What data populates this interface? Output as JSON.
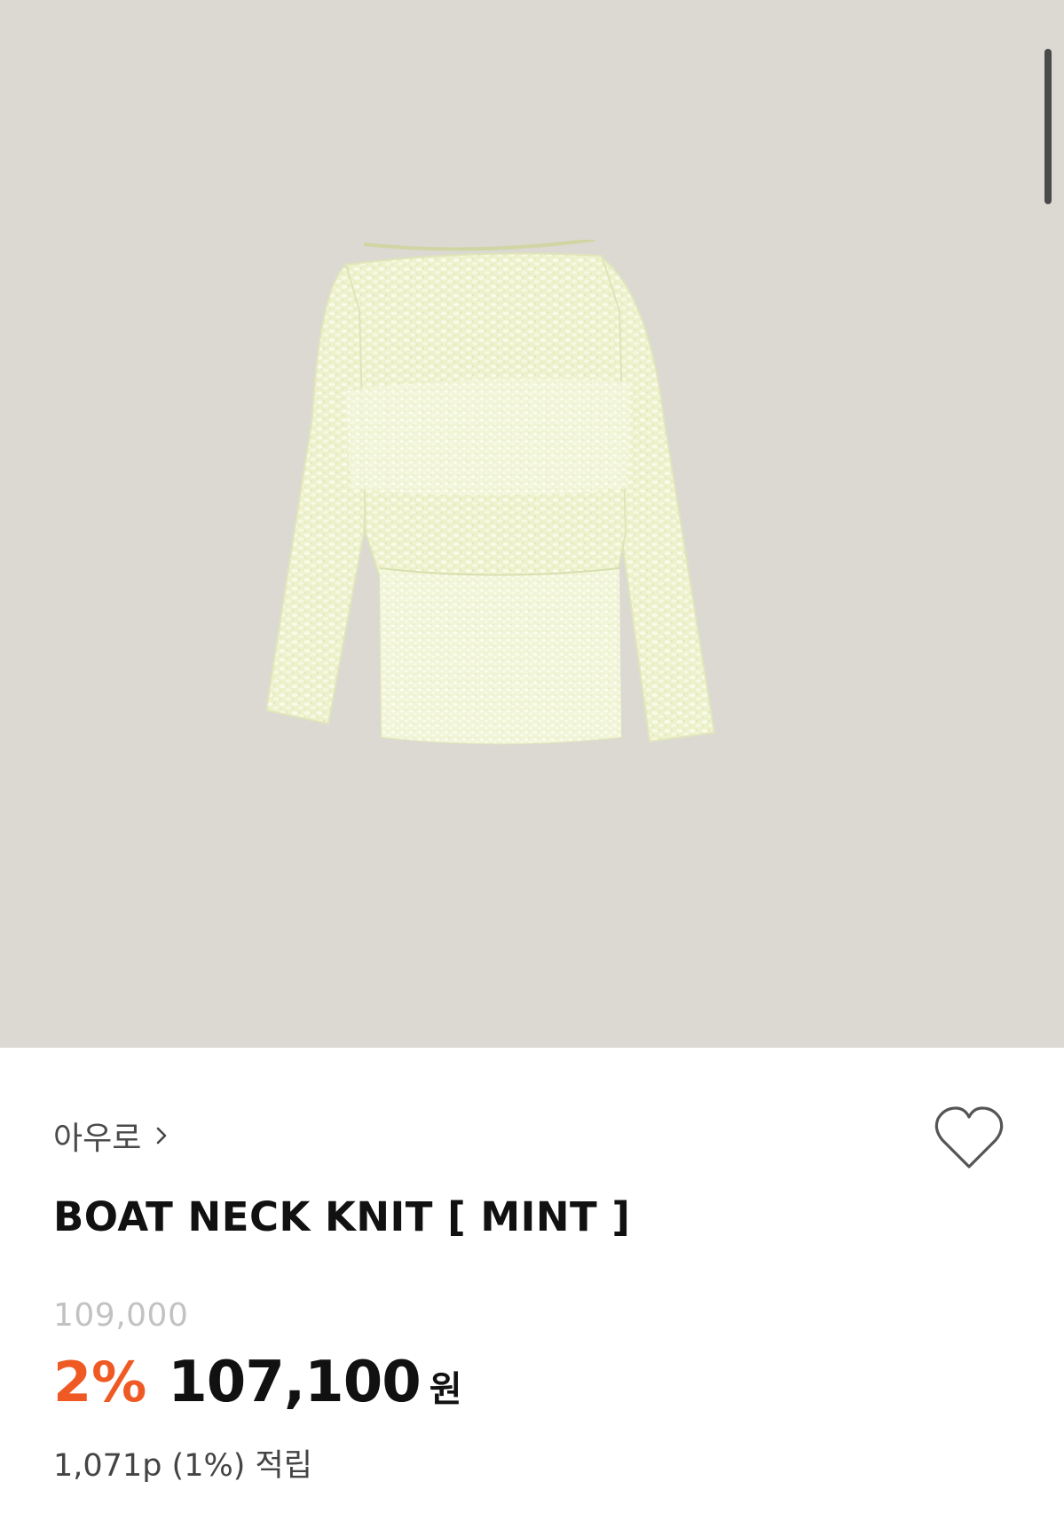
{
  "product": {
    "brand": "아우로",
    "title": "BOAT NECK KNIT [ MINT ]",
    "original_price": "109,000",
    "discount": "2%",
    "sale_price": "107,100",
    "currency": "원",
    "points": "1,071p (1%) 적립"
  },
  "icons": {
    "brand_link": "chevron-right-icon",
    "wishlist": "heart-outline-icon"
  },
  "colors": {
    "hero_background": "#dcd9d3",
    "discount": "#ef5a24",
    "original_price": "#c2c2c2",
    "garment": "#eef3cf"
  }
}
